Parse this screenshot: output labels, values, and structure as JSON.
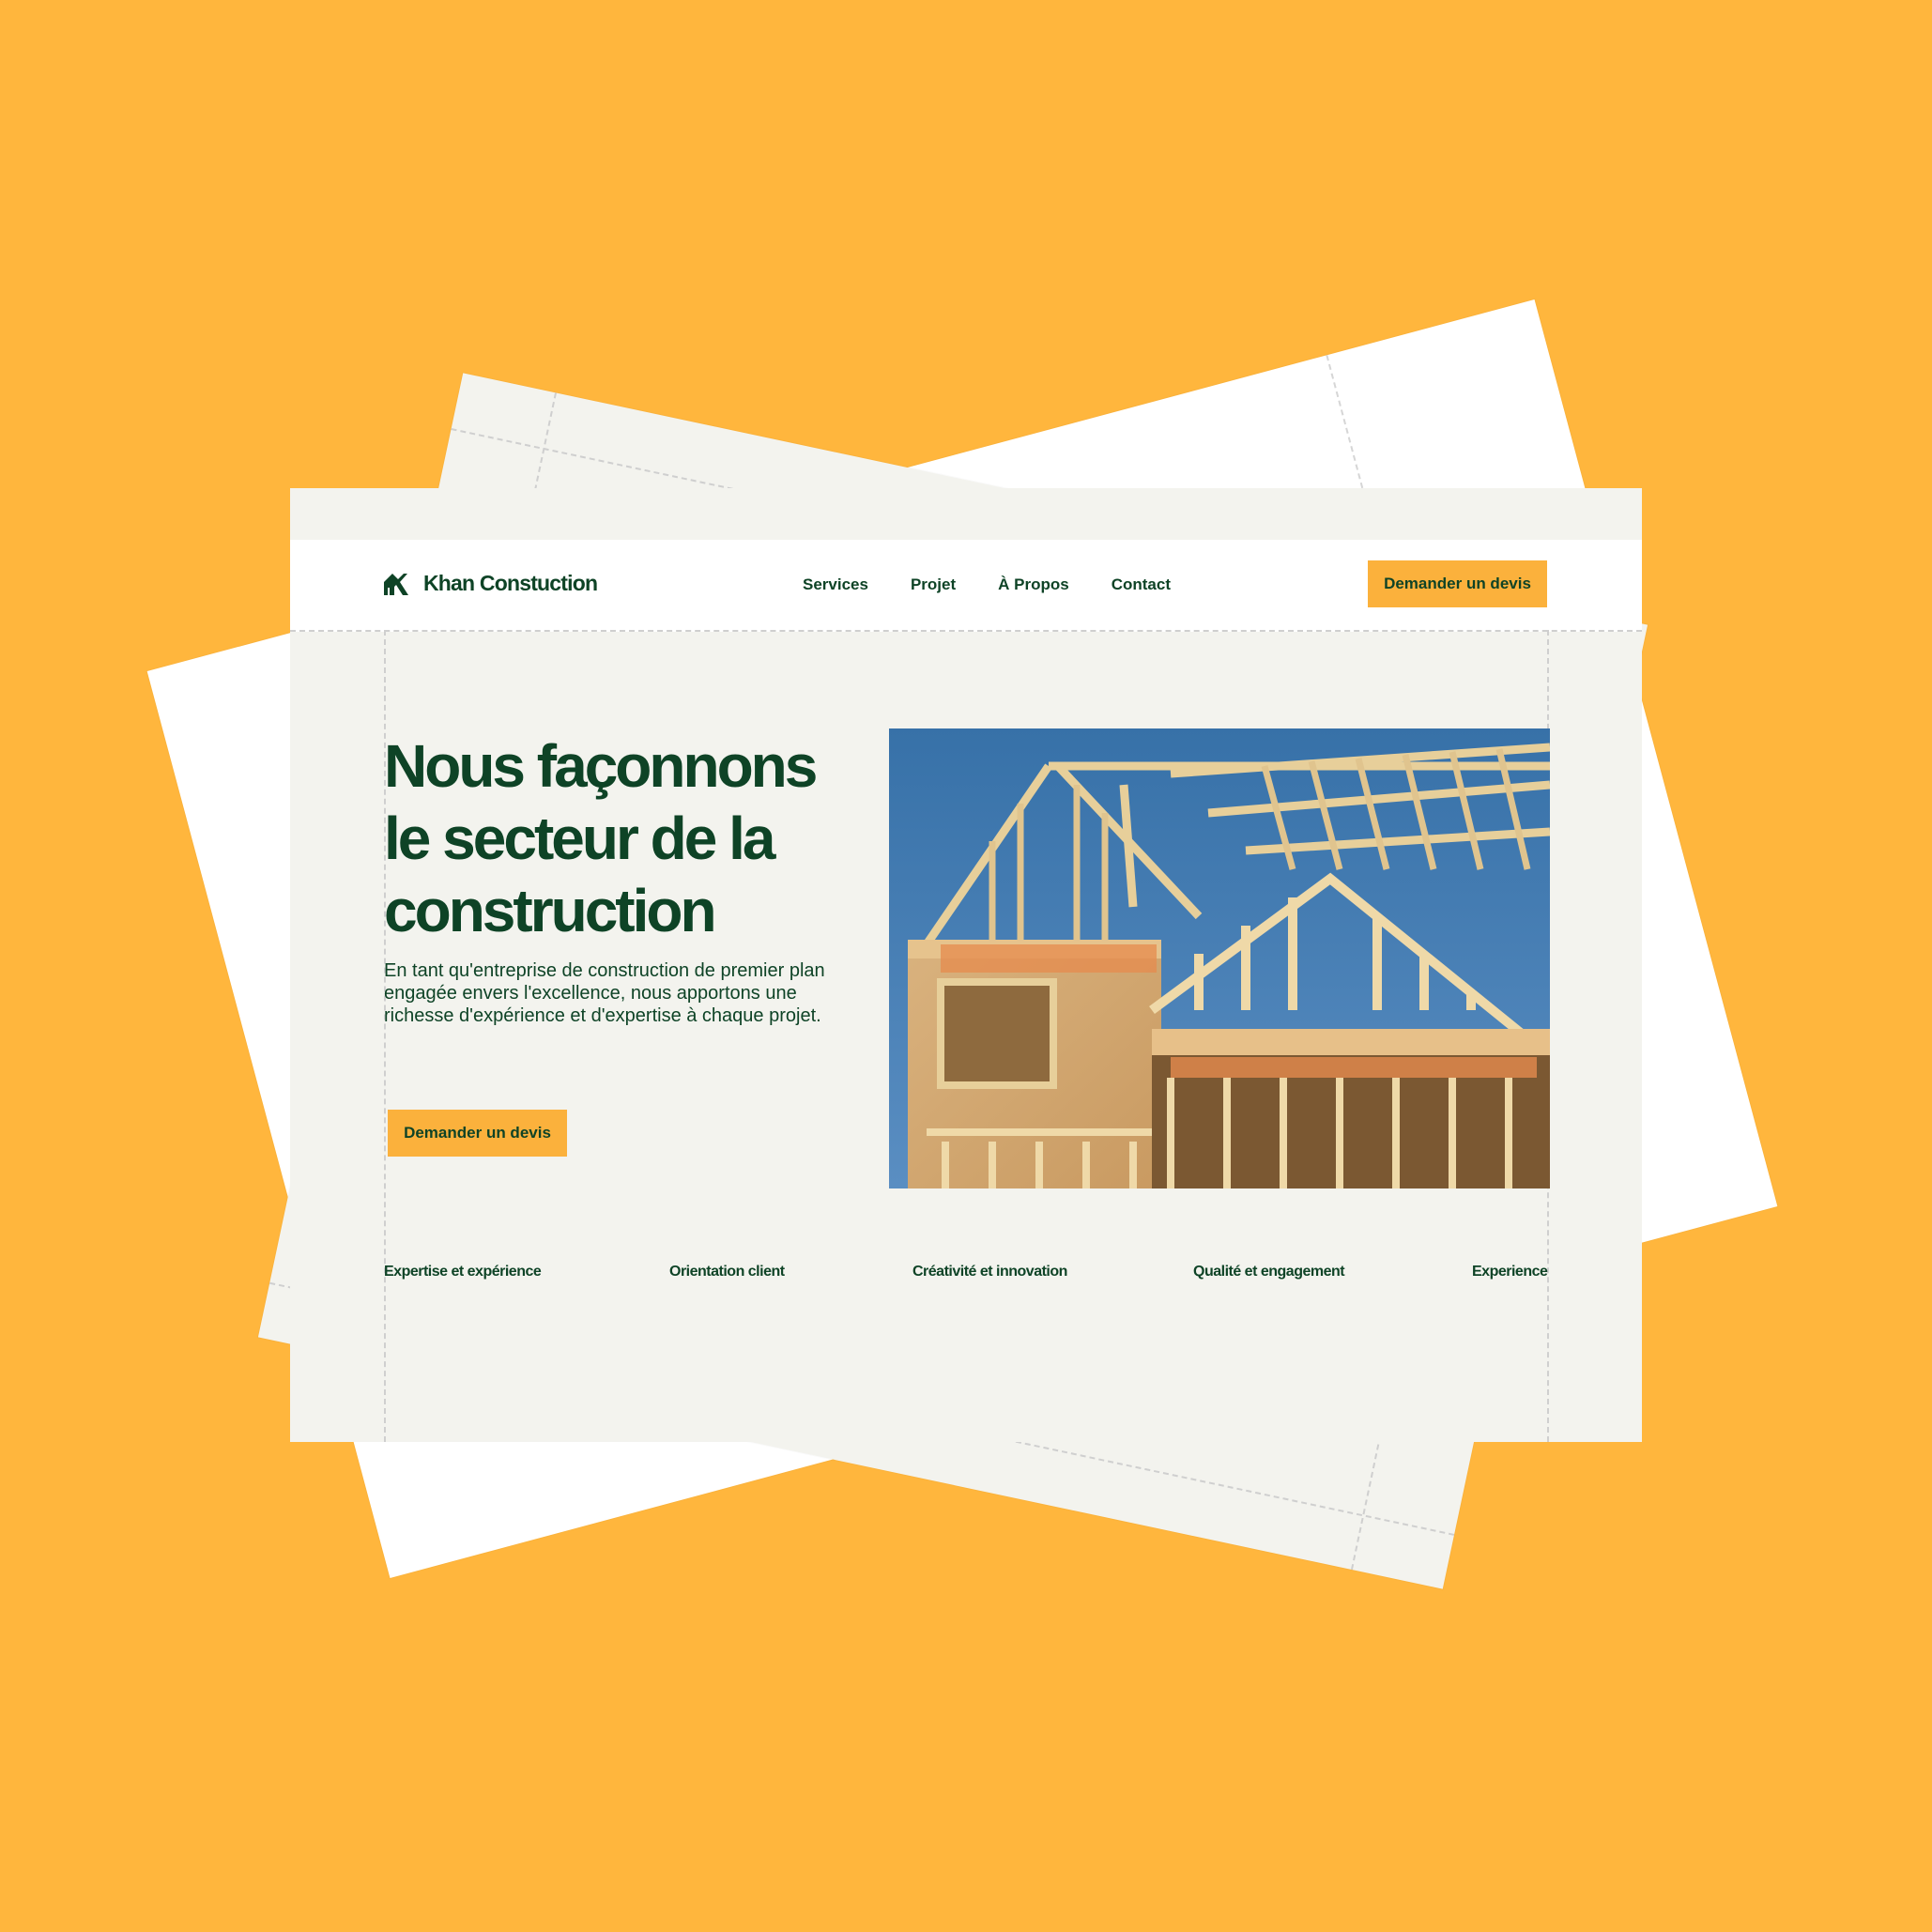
{
  "brand": {
    "name": "Khan Constuction",
    "text_color": "#0E4326",
    "accent": "#FBB13C",
    "background": "#FFB63D"
  },
  "nav": {
    "items": [
      {
        "label": "Services"
      },
      {
        "label": "Projet"
      },
      {
        "label": "À Propos"
      },
      {
        "label": "Contact"
      }
    ],
    "cta_label": "Demander un devis"
  },
  "hero": {
    "title": "Nous façonnons le secteur de la construction",
    "description": "En tant qu'entreprise de construction de premier plan engagée envers l'excellence, nous apportons une richesse d'expérience et d'expertise à chaque projet.",
    "cta_label": "Demander un devis",
    "image_icon": "house-frame-photo"
  },
  "features": [
    {
      "label": "Expertise et expérience"
    },
    {
      "label": "Orientation client"
    },
    {
      "label": "Créativité et innovation"
    },
    {
      "label": "Qualité et engagement"
    },
    {
      "label": "Experience"
    }
  ]
}
